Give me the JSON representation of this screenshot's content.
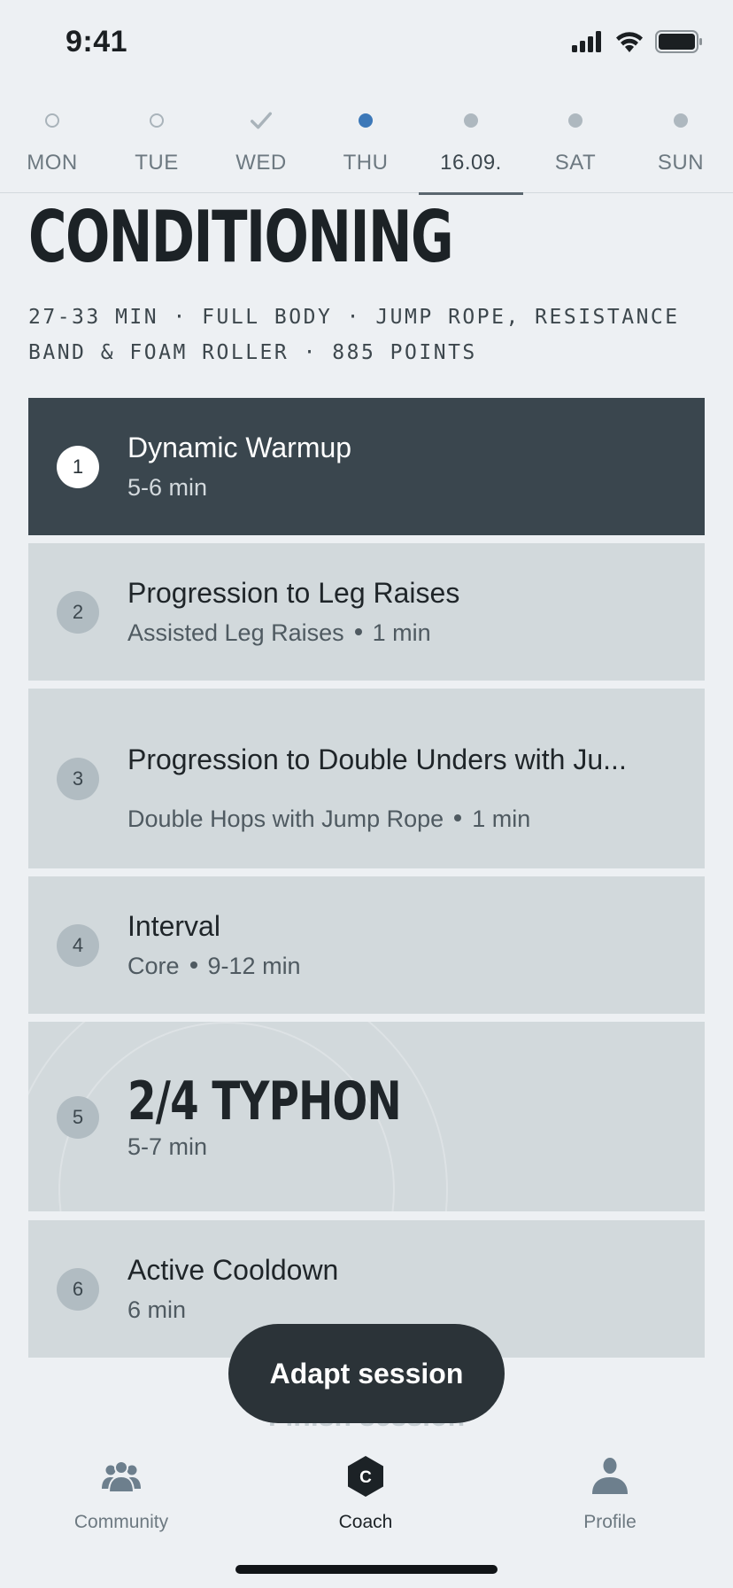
{
  "status_bar": {
    "time": "9:41"
  },
  "week": {
    "days": [
      {
        "label": "MON",
        "state": "empty"
      },
      {
        "label": "TUE",
        "state": "empty"
      },
      {
        "label": "WED",
        "state": "done"
      },
      {
        "label": "THU",
        "state": "active"
      },
      {
        "label": "16.09.",
        "state": "planned",
        "selected": true
      },
      {
        "label": "SAT",
        "state": "planned"
      },
      {
        "label": "SUN",
        "state": "planned"
      }
    ]
  },
  "workout": {
    "title": "CONDITIONING",
    "meta": "27-33 MIN · FULL BODY · JUMP ROPE, RESISTANCE BAND & FOAM ROLLER · 885 POINTS"
  },
  "blocks": [
    {
      "number": "1",
      "title": "Dynamic Warmup",
      "sub": "5-6 min"
    },
    {
      "number": "2",
      "title": "Progression to Leg Raises",
      "sub_a": "Assisted Leg Raises",
      "sub_b": "1 min"
    },
    {
      "number": "3",
      "title": "Progression to Double Unders with Ju...",
      "sub_a": "Double Hops with Jump Rope",
      "sub_b": "1 min"
    },
    {
      "number": "4",
      "title": "Interval",
      "sub_a": "Core",
      "sub_b": "9-12 min"
    },
    {
      "number": "5",
      "title": "2/4 TYPHON",
      "sub": "5-7 min"
    },
    {
      "number": "6",
      "title": "Active Cooldown",
      "sub": "6 min"
    }
  ],
  "actions": {
    "adapt_label": "Adapt session",
    "finish_label": "Finish session"
  },
  "tabs": [
    {
      "label": "Community",
      "icon": "community-icon"
    },
    {
      "label": "Coach",
      "icon": "coach-icon",
      "active": true
    },
    {
      "label": "Profile",
      "icon": "profile-icon"
    }
  ],
  "colors": {
    "background": "#edf0f3",
    "card": "#d2d9dc",
    "card_active": "#3a464e",
    "accent": "#3c78b8",
    "button": "#2b3338"
  }
}
